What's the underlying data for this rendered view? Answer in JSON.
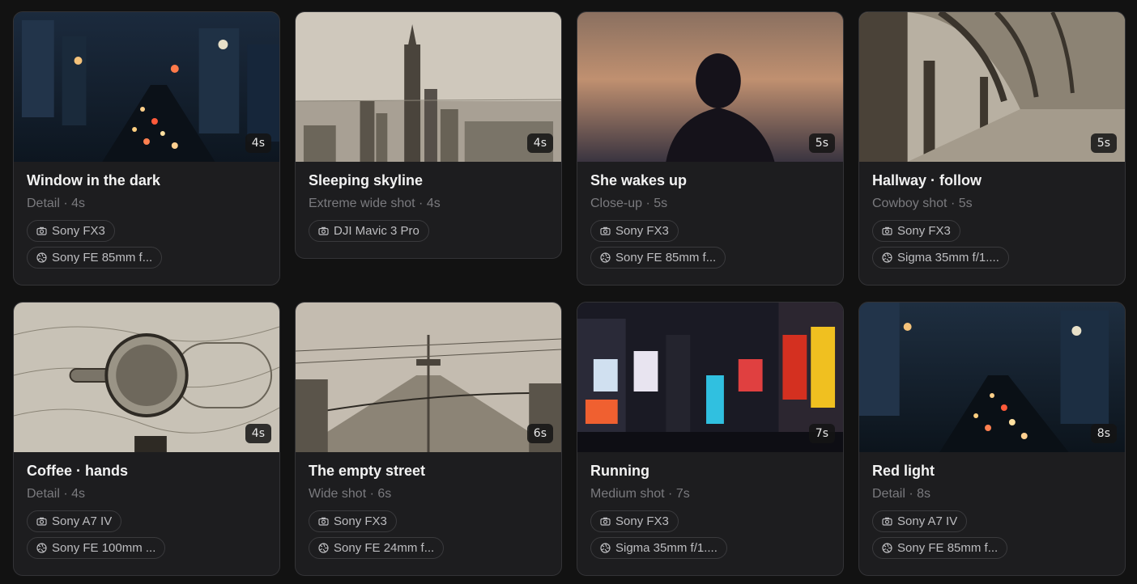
{
  "shots": [
    {
      "title": "Window in the dark",
      "meta": "Detail · 4s",
      "duration": "4s",
      "camera": "Sony FX3",
      "lens": "Sony FE 85mm f...",
      "thumb_icon": "city-night-thumbnail"
    },
    {
      "title": "Sleeping skyline",
      "meta": "Extreme wide shot · 4s",
      "duration": "4s",
      "camera": "DJI Mavic 3 Pro",
      "lens": null,
      "thumb_icon": "skyline-sketch-thumbnail"
    },
    {
      "title": "She wakes up",
      "meta": "Close-up · 5s",
      "duration": "5s",
      "camera": "Sony FX3",
      "lens": "Sony FE 85mm f...",
      "thumb_icon": "woman-silhouette-thumbnail"
    },
    {
      "title": "Hallway · follow",
      "meta": "Cowboy shot · 5s",
      "duration": "5s",
      "camera": "Sony FX3",
      "lens": "Sigma 35mm f/1....",
      "thumb_icon": "arched-hallway-thumbnail"
    },
    {
      "title": "Coffee · hands",
      "meta": "Detail · 4s",
      "duration": "4s",
      "camera": "Sony A7 IV",
      "lens": "Sony FE 100mm ...",
      "thumb_icon": "coffee-cup-thumbnail"
    },
    {
      "title": "The empty street",
      "meta": "Wide shot · 6s",
      "duration": "6s",
      "camera": "Sony FX3",
      "lens": "Sony FE 24mm f...",
      "thumb_icon": "empty-street-thumbnail"
    },
    {
      "title": "Running",
      "meta": "Medium shot · 7s",
      "duration": "7s",
      "camera": "Sony FX3",
      "lens": "Sigma 35mm f/1....",
      "thumb_icon": "times-square-thumbnail"
    },
    {
      "title": "Red light",
      "meta": "Detail · 8s",
      "duration": "8s",
      "camera": "Sony A7 IV",
      "lens": "Sony FE 85mm f...",
      "thumb_icon": "city-traffic-thumbnail"
    }
  ],
  "colors": {
    "background": "#121212",
    "card": "#1d1d1f",
    "card_border": "#333336",
    "title": "#f2f2f2",
    "meta": "#7a7a7e"
  },
  "icons": {
    "camera": "camera-icon",
    "lens": "aperture-icon"
  }
}
